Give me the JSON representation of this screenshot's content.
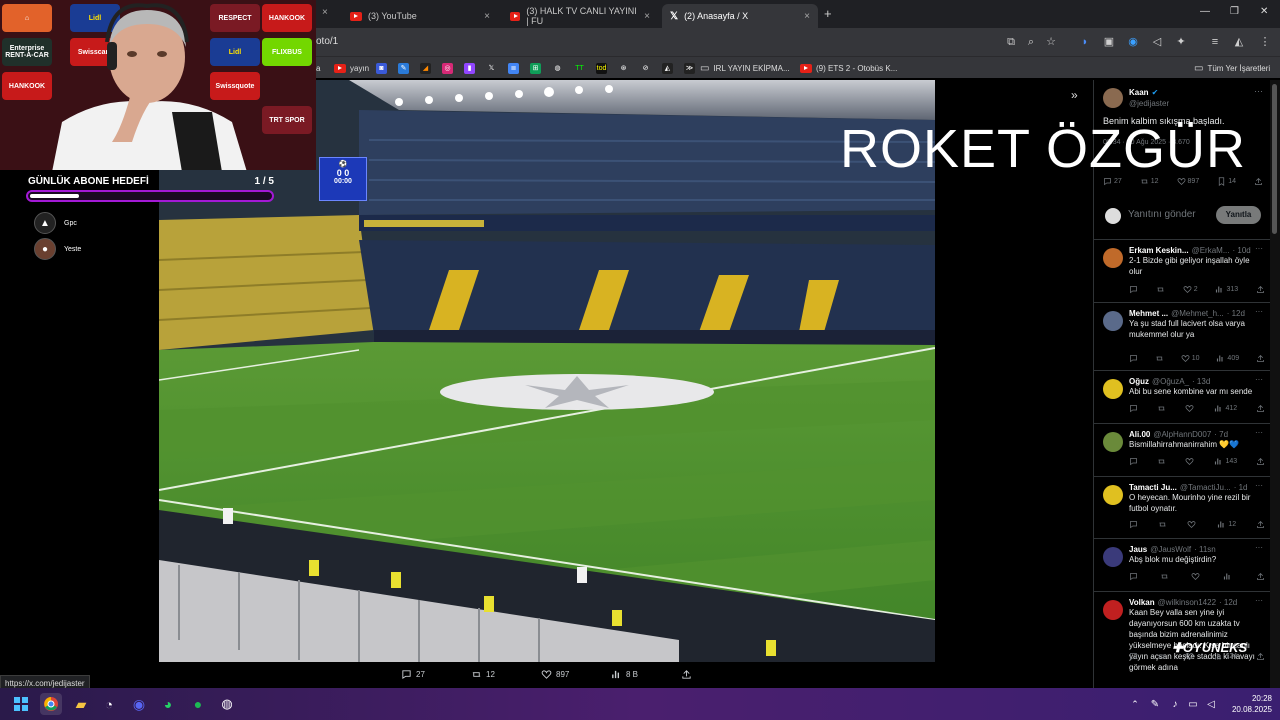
{
  "browser": {
    "tabs": [
      {
        "label": "(3) YouTube",
        "favicon": "youtube-icon",
        "active": false
      },
      {
        "label": "(3) HALK TV CANLI YAYINI | FU",
        "favicon": "youtube-icon",
        "active": false
      },
      {
        "label": "(2) Anasayfa / X",
        "favicon": "x-icon",
        "active": true
      }
    ],
    "new_tab": "+",
    "url": "oto/1",
    "bookmarks": [
      {
        "label": "a",
        "icon": "youtube-icon"
      },
      {
        "label": "yayın",
        "icon": "youtube-icon"
      },
      {
        "label": "",
        "icon": "bookmark-icon"
      },
      {
        "label": "",
        "icon": "bookmark-icon"
      },
      {
        "label": "",
        "icon": "bookmark-icon"
      },
      {
        "label": "",
        "icon": "instagram-icon"
      },
      {
        "label": "",
        "icon": "twitch-icon"
      },
      {
        "label": "",
        "icon": "x-icon"
      },
      {
        "label": "",
        "icon": "docs-icon"
      },
      {
        "label": "",
        "icon": "sheets-icon"
      },
      {
        "label": "",
        "icon": "spotify-icon"
      },
      {
        "label": "",
        "icon": "tt-icon"
      },
      {
        "label": "",
        "icon": "tod-icon"
      },
      {
        "label": "",
        "icon": "web-icon"
      },
      {
        "label": "",
        "icon": "bookmark-icon"
      },
      {
        "label": "",
        "icon": "bookmark-icon"
      },
      {
        "label": "",
        "icon": "bookmark-icon"
      },
      {
        "label": "IRL YAYIN EKİPMA...",
        "icon": "folder-icon"
      },
      {
        "label": "(9) ETS 2 - Otobüs K...",
        "icon": "youtube-icon"
      }
    ],
    "all_bookmarks": "Tüm Yer İşaretleri",
    "status_url": "https://x.com/jedijaster"
  },
  "overlay": {
    "goal_title": "GÜNLÜK ABONE HEDEFİ",
    "goal_count": "1 / 5",
    "goal_progress": 0.2,
    "viewers": [
      {
        "name": "Gpc",
        "icon": "adidas-icon"
      },
      {
        "name": "Yeste",
        "icon": "avatar-icon"
      }
    ],
    "sponsors": [
      "Lidl",
      "RESPECT",
      "HANKOOK",
      "Enterprise RENT-A-CAR",
      "Swisscare",
      "Lidl",
      "FLIXBUS",
      "HANKOOK",
      "Swissquote",
      "TRT SPOR"
    ],
    "title": "ROKET ÖZGÜR",
    "brand": "OYUNEKS"
  },
  "scoreboard": {
    "score": "0 0",
    "time": "00:00"
  },
  "post_actions": {
    "replies": "27",
    "reposts": "12",
    "likes": "897",
    "views": "8 B"
  },
  "tweet": {
    "author": "Kaan",
    "handle": "@jedijaster",
    "text": "Benim kalbim sıkışma başladı.",
    "meta": "08:34 · 20 Ağu 2025 · 8.670",
    "stats": {
      "replies": "27",
      "reposts": "12",
      "likes": "897",
      "bookmarks": "14"
    },
    "reply_placeholder": "Yanıtını gönder",
    "reply_button": "Yanıtla"
  },
  "replies": [
    {
      "author": "Erkam Keskin...",
      "handle": "@ErkaM...",
      "time": "· 10d",
      "text": "2-1 Bizde gibi geliyor inşallah öyle olur",
      "likes": "2",
      "views": "313",
      "color": "#c06a2a"
    },
    {
      "author": "Mehmet ...",
      "handle": "@Mehmet_h...",
      "time": "· 12d",
      "text": "Ya şu stad full lacivert olsa varya mukemmel olur ya",
      "likes": "10",
      "views": "409",
      "color": "#5a6a8a"
    },
    {
      "author": "Oğuz",
      "handle": "@OğuzA_",
      "time": "· 13d",
      "text": "Abi bu sene kombine var mı sende",
      "likes": "",
      "views": "412",
      "color": "#e0c020"
    },
    {
      "author": "Ali.00",
      "handle": "@AlpHannD007",
      "time": "· 7d",
      "text": "Bismillahirrahmanirrahim 💛💙",
      "likes": "",
      "views": "143",
      "color": "#6a8a3a"
    },
    {
      "author": "Tamacti Ju...",
      "handle": "@TamactiJu...",
      "time": "· 1d",
      "text": "O heyecan. Mourinho yine rezil bir futbol oynatır.",
      "likes": "",
      "views": "12",
      "color": "#e0c020"
    },
    {
      "author": "Jaus",
      "handle": "@JausWolf",
      "time": "· 11sn",
      "text": "Abş blok mu değiştirdin?",
      "likes": "",
      "views": "",
      "color": "#3a3a7a"
    },
    {
      "author": "Volkan",
      "handle": "@wilkinson1422",
      "time": "· 12d",
      "text": "Kaan Bey valla sen yine iyi dayanıyorsun 600 km uzakta tv başında bizim adrenalinimiz yükselmeye başladı. Kısa bir canlı yayın açsan keşke stadda ki havayı görmek adına",
      "likes": "",
      "views": "124",
      "color": "#c02020"
    }
  ],
  "taskbar": {
    "time": "20:28",
    "date": "20.08.2025"
  }
}
